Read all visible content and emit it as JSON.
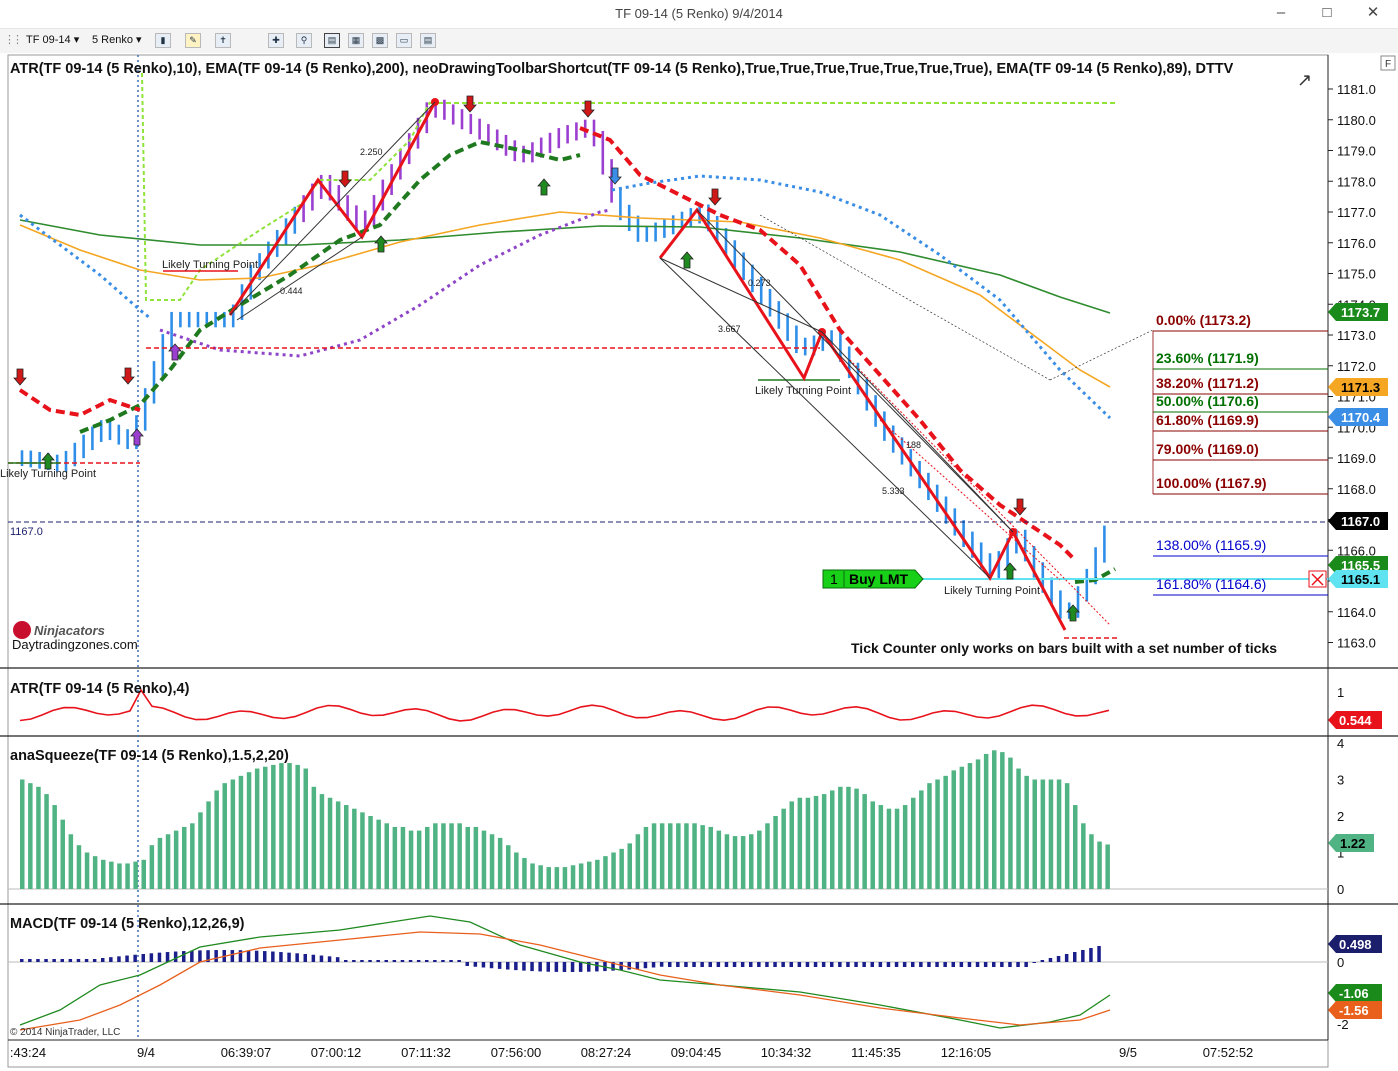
{
  "window": {
    "title": "TF 09-14 (5 Renko)  9/4/2014"
  },
  "toolbar": {
    "instrument": "TF 09-14",
    "period": "5 Renko"
  },
  "chart_data": [
    {
      "type": "candlestick",
      "title": "ATR(TF 09-14 (5 Renko),10),  EMA(TF 09-14 (5 Renko),200),  neoDrawingToolbarShortcut(TF 09-14 (5 Renko),True,True,True,True,True,True,True),  EMA(TF 09-14 (5 Renko),89),  DTTV",
      "price_axis_ticks": [
        "1181.0",
        "1180.0",
        "1179.0",
        "1178.0",
        "1177.0",
        "1176.0",
        "1175.0",
        "1174.0",
        "1173.0",
        "1172.0",
        "1171.0",
        "1170.0",
        "1169.0",
        "1168.0",
        "1167.0",
        "1166.0",
        "1165.0",
        "1164.0",
        "1163.0"
      ],
      "ylim": [
        1162.8,
        1181.4
      ],
      "time_axis_labels": [
        ":43:24",
        "9/4",
        "06:39:07",
        "07:00:12",
        "07:11:32",
        "07:56:00",
        "08:27:24",
        "09:04:45",
        "10:34:32",
        "11:45:35",
        "12:16:05",
        "9/5",
        "07:52:52"
      ],
      "price_markers": [
        {
          "label": "1173.7",
          "color": "#1a8a1a"
        },
        {
          "label": "1171.3",
          "color": "#f5a623"
        },
        {
          "label": "1170.4",
          "color": "#3a8ee6"
        },
        {
          "label": "1167.0",
          "color": "#000000"
        },
        {
          "label": "1165.5",
          "color": "#1a8a1a"
        },
        {
          "label": "1165.1",
          "color": "#5fe3f0"
        }
      ],
      "last_price_label": "1167.0",
      "fibonacci": [
        {
          "text": "0.00% (1173.2)",
          "color": "#8b0000"
        },
        {
          "text": "23.60% (1171.9)",
          "color": "#007000"
        },
        {
          "text": "38.20% (1171.2)",
          "color": "#8b0000"
        },
        {
          "text": "50.00% (1170.6)",
          "color": "#007000"
        },
        {
          "text": "61.80% (1169.9)",
          "color": "#8b0000"
        },
        {
          "text": "79.00% (1169.0)",
          "color": "#8b0000"
        },
        {
          "text": "100.00% (1167.9)",
          "color": "#8b0000"
        },
        {
          "text": "138.00% (1165.9)",
          "color": "#0000cc"
        },
        {
          "text": "161.80% (1164.6)",
          "color": "#0000cc"
        }
      ],
      "annotations": [
        "Likely Turning Point",
        "Likely Turning Point",
        "Likely Turning Point",
        "Likely Turning Point",
        "2.250",
        "0.444",
        "0.273",
        "3.667",
        "188",
        "5.333"
      ],
      "order": {
        "qty": "1",
        "label": "Buy LMT",
        "price": 1165.1
      },
      "tick_note": "Tick Counter only works on bars built with a set number of ticks",
      "logo": {
        "name": "Ninjacators",
        "site": "Daytradingzones.com"
      }
    },
    {
      "type": "line",
      "title": "ATR(TF 09-14 (5 Renko),4)",
      "axis_ticks": [
        "1"
      ],
      "value_label": "0.544",
      "color": "#e8121b"
    },
    {
      "type": "bar",
      "title": "anaSqueeze(TF 09-14 (5 Renko),1.5,2,20)",
      "axis_ticks": [
        "4",
        "3",
        "2",
        "1",
        "0"
      ],
      "value_label": "1.22",
      "ylim": [
        0,
        4
      ],
      "values": [
        3.0,
        2.9,
        2.8,
        2.6,
        2.3,
        1.9,
        1.5,
        1.2,
        1.0,
        0.9,
        0.8,
        0.75,
        0.7,
        0.7,
        0.75,
        0.8,
        1.2,
        1.4,
        1.5,
        1.6,
        1.7,
        1.8,
        2.1,
        2.4,
        2.7,
        2.9,
        3.0,
        3.1,
        3.2,
        3.3,
        3.35,
        3.4,
        3.45,
        3.45,
        3.4,
        3.3,
        2.8,
        2.6,
        2.5,
        2.4,
        2.3,
        2.2,
        2.1,
        2.0,
        1.9,
        1.8,
        1.7,
        1.7,
        1.6,
        1.6,
        1.7,
        1.8,
        1.8,
        1.8,
        1.8,
        1.7,
        1.7,
        1.6,
        1.5,
        1.4,
        1.2,
        1.0,
        0.85,
        0.7,
        0.65,
        0.6,
        0.6,
        0.6,
        0.65,
        0.7,
        0.75,
        0.8,
        0.9,
        1.0,
        1.1,
        1.25,
        1.5,
        1.7,
        1.8,
        1.8,
        1.8,
        1.8,
        1.8,
        1.8,
        1.75,
        1.7,
        1.6,
        1.5,
        1.45,
        1.45,
        1.5,
        1.6,
        1.8,
        2.0,
        2.2,
        2.4,
        2.5,
        2.5,
        2.55,
        2.6,
        2.7,
        2.8,
        2.8,
        2.75,
        2.6,
        2.4,
        2.3,
        2.2,
        2.2,
        2.3,
        2.5,
        2.7,
        2.9,
        3.0,
        3.1,
        3.25,
        3.35,
        3.45,
        3.55,
        3.7,
        3.8,
        3.75,
        3.6,
        3.3,
        3.1,
        3.0,
        3.0,
        3.0,
        3.0,
        2.9,
        2.3,
        1.8,
        1.5,
        1.3,
        1.22
      ]
    },
    {
      "type": "line",
      "title": "MACD(TF 09-14 (5 Renko),12,26,9)",
      "axis_ticks": [
        "0",
        "-2"
      ],
      "value_labels": [
        {
          "label": "0.498",
          "color": "#1b1f6b"
        },
        {
          "label": "-1.06",
          "color": "#1a8a1a"
        },
        {
          "label": "-1.56",
          "color": "#e8601c"
        }
      ],
      "copyright": "© 2014 NinjaTrader, LLC"
    }
  ]
}
